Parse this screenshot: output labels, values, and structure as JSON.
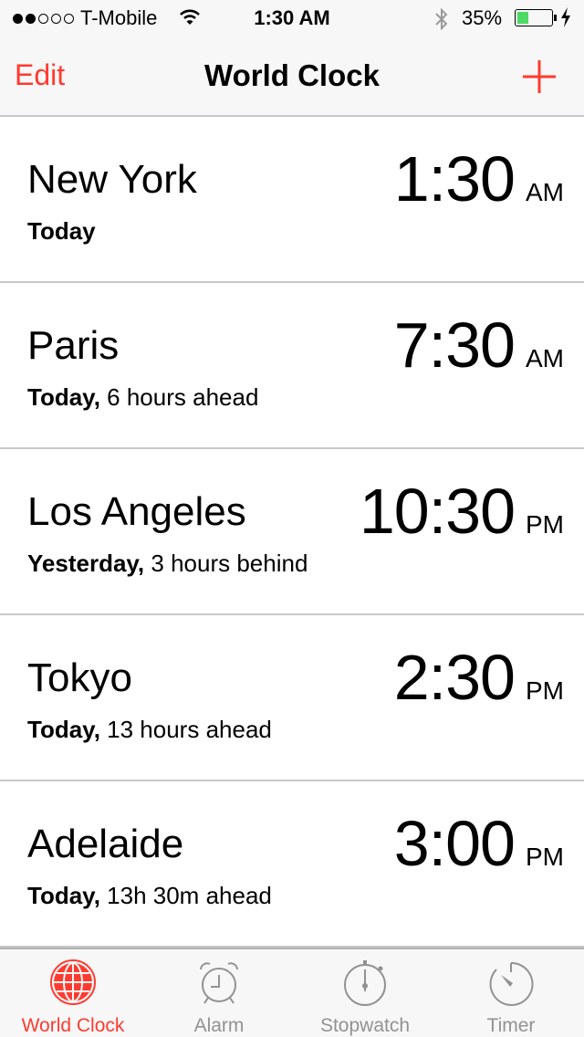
{
  "status_bar": {
    "signal_bars_filled": 2,
    "signal_bars_total": 5,
    "carrier": "T-Mobile",
    "time": "1:30 AM",
    "battery_percent_label": "35%",
    "battery_level": 0.35,
    "icons": [
      "wifi-icon",
      "bluetooth-icon",
      "battery-icon",
      "charging-bolt-icon"
    ],
    "battery_color": "#4cd964"
  },
  "nav": {
    "edit_label": "Edit",
    "title": "World Clock",
    "add_icon": "plus-icon",
    "accent_color": "#ff3b30"
  },
  "clocks": [
    {
      "city": "New York",
      "day": "Today",
      "offset": "",
      "time": "1:30",
      "ampm": "AM"
    },
    {
      "city": "Paris",
      "day": "Today,",
      "offset": " 6 hours ahead",
      "time": "7:30",
      "ampm": "AM"
    },
    {
      "city": "Los Angeles",
      "day": "Yesterday,",
      "offset": " 3 hours behind",
      "time": "10:30",
      "ampm": "PM"
    },
    {
      "city": "Tokyo",
      "day": "Today,",
      "offset": " 13 hours ahead",
      "time": "2:30",
      "ampm": "PM"
    },
    {
      "city": "Adelaide",
      "day": "Today,",
      "offset": " 13h 30m ahead",
      "time": "3:00",
      "ampm": "PM"
    }
  ],
  "tabs": [
    {
      "label": "World Clock",
      "icon": "globe-icon",
      "active": true
    },
    {
      "label": "Alarm",
      "icon": "alarm-clock-icon",
      "active": false
    },
    {
      "label": "Stopwatch",
      "icon": "stopwatch-icon",
      "active": false
    },
    {
      "label": "Timer",
      "icon": "timer-icon",
      "active": false
    }
  ]
}
